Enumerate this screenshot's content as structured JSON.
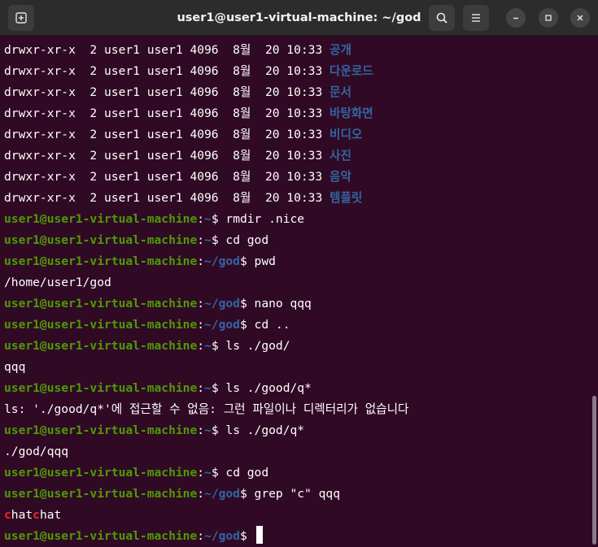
{
  "window": {
    "title": "user1@user1-virtual-machine: ~/god",
    "icons": [
      "new-tab-icon",
      "search-icon",
      "hamburger-menu-icon",
      "minimize-icon",
      "maximize-icon",
      "close-icon"
    ]
  },
  "colors": {
    "terminal_bg": "#300a24",
    "prompt_user": "#4e9a06",
    "prompt_path": "#3465a4",
    "directory": "#3465a4",
    "grep_match": "#ef2929",
    "text": "#ffffff"
  },
  "listing": [
    {
      "perms": "drwxr-xr-x  2 user1 user1 4096  8월  20 10:33 ",
      "name": "공개"
    },
    {
      "perms": "drwxr-xr-x  2 user1 user1 4096  8월  20 10:33 ",
      "name": "다운로드"
    },
    {
      "perms": "drwxr-xr-x  2 user1 user1 4096  8월  20 10:33 ",
      "name": "문서"
    },
    {
      "perms": "drwxr-xr-x  2 user1 user1 4096  8월  20 10:33 ",
      "name": "바탕화면"
    },
    {
      "perms": "drwxr-xr-x  2 user1 user1 4096  8월  20 10:33 ",
      "name": "비디오"
    },
    {
      "perms": "drwxr-xr-x  2 user1 user1 4096  8월  20 10:33 ",
      "name": "사진"
    },
    {
      "perms": "drwxr-xr-x  2 user1 user1 4096  8월  20 10:33 ",
      "name": "음악"
    },
    {
      "perms": "drwxr-xr-x  2 user1 user1 4096  8월  20 10:33 ",
      "name": "템플릿"
    }
  ],
  "prompt": {
    "user_host": "user1@user1-virtual-machine",
    "colon": ":",
    "home": "~",
    "god": "~/god",
    "dollar": "$ "
  },
  "lines": {
    "c1": "rmdir .nice",
    "c2": "cd god",
    "c3": "pwd",
    "o3": "/home/user1/god",
    "c4": "nano qqq",
    "c5": "cd ..",
    "c6": "ls ./god/",
    "o6": "qqq",
    "c7": "ls ./good/q*",
    "o7": "ls: './good/q*'에 접근할 수 없음: 그런 파일이나 디렉터리가 없습니다",
    "c8": "ls ./god/q*",
    "o8": "./god/qqq",
    "c9": "cd god",
    "c10": "grep \"c\" qqq",
    "o10": {
      "m1": "c",
      "t1": "hat",
      "m2": "c",
      "t2": "hat"
    }
  }
}
